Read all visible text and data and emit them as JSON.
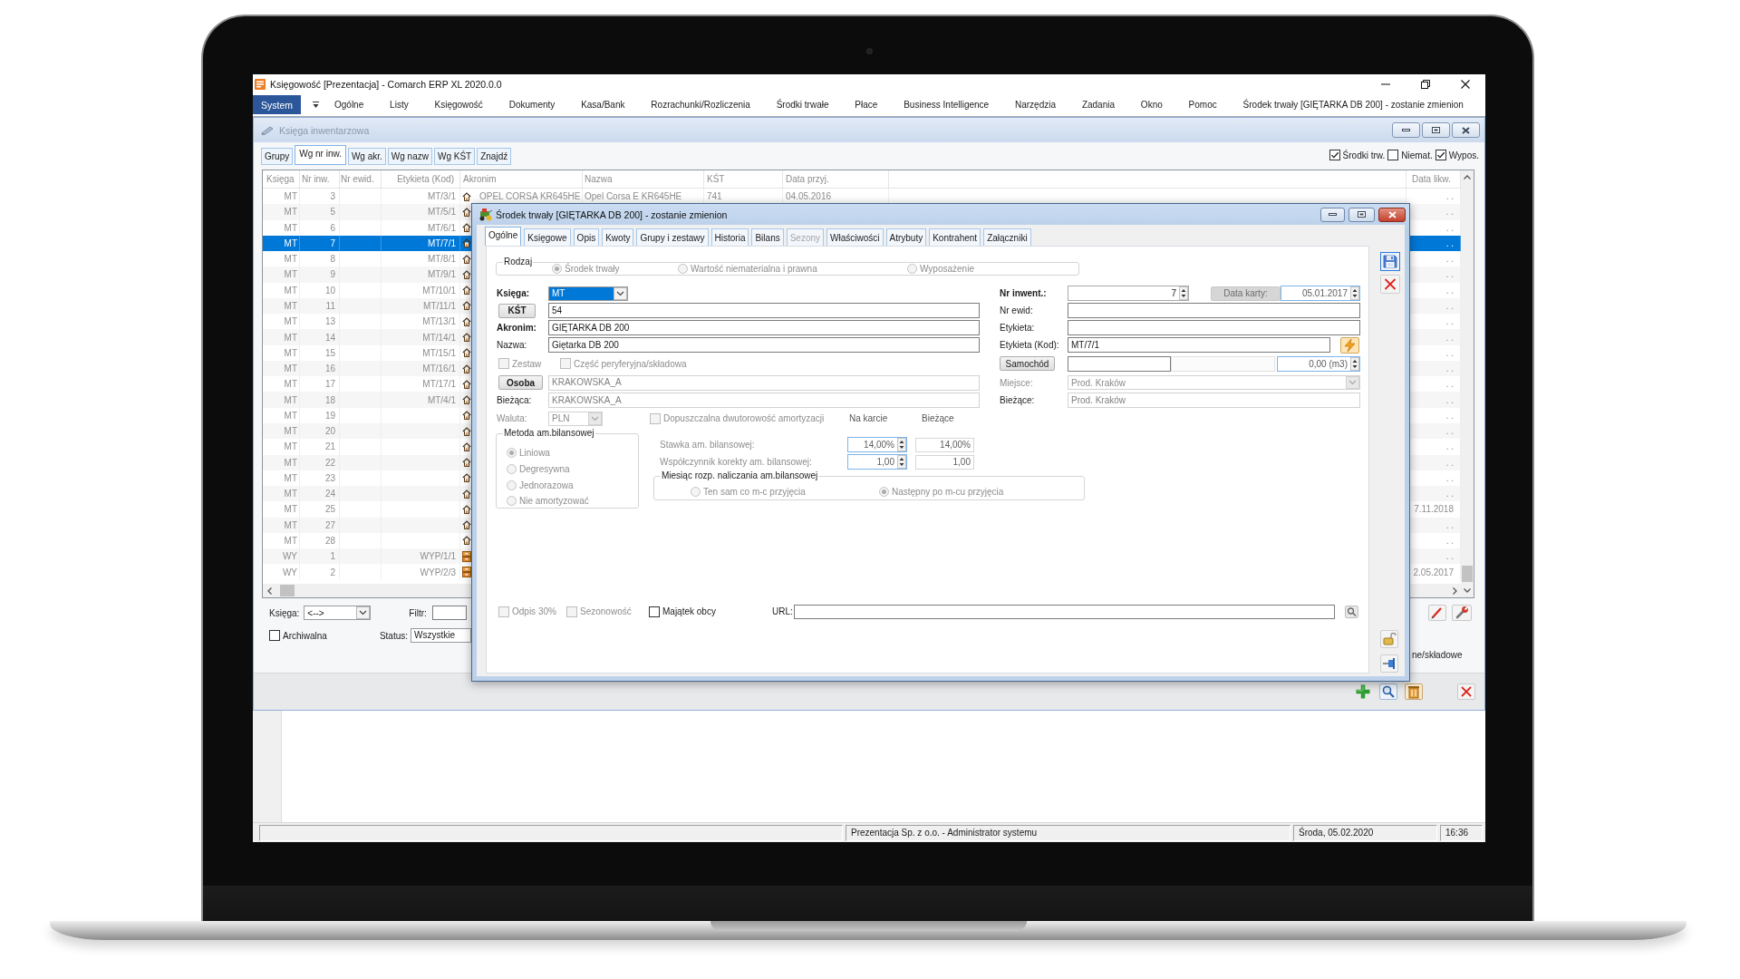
{
  "window": {
    "title": "Księgowość [Prezentacja] - Comarch ERP XL 2020.0.0"
  },
  "menu": [
    {
      "label": "System",
      "kind": "app"
    },
    {
      "label": "Ogólne",
      "kind": "menu"
    },
    {
      "label": "Listy",
      "kind": "menu"
    },
    {
      "label": "Księgowość",
      "kind": "menu"
    },
    {
      "label": "Dokumenty",
      "kind": "menu"
    },
    {
      "label": "Kasa/Bank",
      "kind": "menu"
    },
    {
      "label": "Rozrachunki/Rozliczenia",
      "kind": "menu"
    },
    {
      "label": "Środki trwałe",
      "kind": "menu"
    },
    {
      "label": "Płace",
      "kind": "menu"
    },
    {
      "label": "Business Intelligence",
      "kind": "menu"
    },
    {
      "label": "Narzędzia",
      "kind": "menu"
    },
    {
      "label": "Zadania",
      "kind": "menu"
    },
    {
      "label": "Okno",
      "kind": "menu"
    },
    {
      "label": "Pomoc",
      "kind": "menu"
    },
    {
      "label": "Środek trwały [GIĘTARKA DB 200] - zostanie zmienion",
      "kind": "menu"
    }
  ],
  "register": {
    "title": "Księga inwentarzowa",
    "tabs": [
      {
        "label": "Grupy",
        "selected": false
      },
      {
        "label": "Wg nr inw.",
        "selected": true
      },
      {
        "label": "Wg akr.",
        "selected": false
      },
      {
        "label": "Wg nazw",
        "selected": false
      },
      {
        "label": "Wg KŚT",
        "selected": false
      },
      {
        "label": "Znajdź",
        "selected": false
      }
    ],
    "filters": [
      {
        "label": "Środki trw.",
        "checked": true
      },
      {
        "label": "Niemat.",
        "checked": false
      },
      {
        "label": "Wypos.",
        "checked": true
      }
    ],
    "table": {
      "columns": [
        "Księga",
        "Nr inw.",
        "Nr ewid.",
        "Etykieta (Kod)",
        "Akronim",
        "Nazwa",
        "KŚT",
        "Data przyj.",
        "Data likw."
      ],
      "rows": [
        {
          "kind": "fixed",
          "book": "MT",
          "number": "3",
          "label_code": "MT/3/1",
          "acronym": "OPEL CORSA KR645HE",
          "name": "Opel Corsa E KR645HE",
          "kst": "741",
          "acquired": "04.05.2016",
          "disposed": ". .",
          "selected": false
        },
        {
          "kind": "fixed",
          "book": "MT",
          "number": "5",
          "label_code": "MT/5/1",
          "disposed": ". .",
          "selected": false
        },
        {
          "kind": "fixed",
          "book": "MT",
          "number": "6",
          "label_code": "MT/6/1",
          "disposed": ". .",
          "selected": false
        },
        {
          "kind": "fixed",
          "book": "MT",
          "number": "7",
          "label_code": "MT/7/1",
          "disposed": ". .",
          "selected": true
        },
        {
          "kind": "fixed",
          "book": "MT",
          "number": "8",
          "label_code": "MT/8/1",
          "disposed": ". .",
          "selected": false
        },
        {
          "kind": "fixed",
          "book": "MT",
          "number": "9",
          "label_code": "MT/9/1",
          "disposed": ". .",
          "selected": false
        },
        {
          "kind": "fixed",
          "book": "MT",
          "number": "10",
          "label_code": "MT/10/1",
          "disposed": ". .",
          "selected": false
        },
        {
          "kind": "fixed",
          "book": "MT",
          "number": "11",
          "label_code": "MT/11/1",
          "disposed": ". .",
          "selected": false
        },
        {
          "kind": "fixed",
          "book": "MT",
          "number": "13",
          "label_code": "MT/13/1",
          "disposed": ". .",
          "selected": false
        },
        {
          "kind": "fixed",
          "book": "MT",
          "number": "14",
          "label_code": "MT/14/1",
          "disposed": ". .",
          "selected": false
        },
        {
          "kind": "fixed",
          "book": "MT",
          "number": "15",
          "label_code": "MT/15/1",
          "disposed": ". .",
          "selected": false
        },
        {
          "kind": "fixed",
          "book": "MT",
          "number": "16",
          "label_code": "MT/16/1",
          "disposed": ". .",
          "selected": false
        },
        {
          "kind": "fixed",
          "book": "MT",
          "number": "17",
          "label_code": "MT/17/1",
          "disposed": ". .",
          "selected": false
        },
        {
          "kind": "fixed",
          "book": "MT",
          "number": "18",
          "label_code": "MT/4/1",
          "disposed": ". .",
          "selected": false
        },
        {
          "kind": "fixed",
          "book": "MT",
          "number": "19",
          "disposed": ". .",
          "selected": false
        },
        {
          "kind": "fixed",
          "book": "MT",
          "number": "20",
          "disposed": ". .",
          "selected": false
        },
        {
          "kind": "fixed",
          "book": "MT",
          "number": "21",
          "disposed": ". .",
          "selected": false
        },
        {
          "kind": "fixed",
          "book": "MT",
          "number": "22",
          "disposed": ". .",
          "selected": false
        },
        {
          "kind": "fixed",
          "book": "MT",
          "number": "23",
          "disposed": ". .",
          "selected": false
        },
        {
          "kind": "fixed",
          "book": "MT",
          "number": "24",
          "disposed": ". .",
          "selected": false
        },
        {
          "kind": "fixed",
          "book": "MT",
          "number": "25",
          "disposed": "7.11.2018",
          "selected": false
        },
        {
          "kind": "fixed",
          "book": "MT",
          "number": "27",
          "disposed": ". .",
          "selected": false
        },
        {
          "kind": "fixed",
          "book": "MT",
          "number": "28",
          "disposed": ". .",
          "selected": false
        },
        {
          "kind": "equipment",
          "book": "WY",
          "number": "1",
          "label_code": "WYP/1/1",
          "disposed": ". .",
          "selected": false
        },
        {
          "kind": "equipment",
          "book": "WY",
          "number": "2",
          "label_code": "WYP/2/3",
          "disposed": "2.05.2017",
          "selected": false
        }
      ]
    },
    "book": {
      "label": "Księga:",
      "value": "<-->"
    },
    "filter": {
      "label": "Filtr:"
    },
    "archived": {
      "label": "Archiwalna",
      "checked": false
    },
    "status": {
      "label": "Status:",
      "value": "Wszystkie"
    },
    "parts_label": "ne/składowe"
  },
  "dialog": {
    "title": "Środek trwały [GIĘTARKA DB 200] - zostanie zmienion",
    "tabs": [
      {
        "label": "Ogólne",
        "selected": true,
        "disabled": false
      },
      {
        "label": "Księgowe",
        "selected": false,
        "disabled": false
      },
      {
        "label": "Opis",
        "selected": false,
        "disabled": false
      },
      {
        "label": "Kwoty",
        "selected": false,
        "disabled": false
      },
      {
        "label": "Grupy i zestawy",
        "selected": false,
        "disabled": false
      },
      {
        "label": "Historia",
        "selected": false,
        "disabled": false
      },
      {
        "label": "Bilans",
        "selected": false,
        "disabled": false
      },
      {
        "label": "Sezony",
        "selected": false,
        "disabled": true
      },
      {
        "label": "Właściwości",
        "selected": false,
        "disabled": false
      },
      {
        "label": "Atrybuty",
        "selected": false,
        "disabled": false
      },
      {
        "label": "Kontrahent",
        "selected": false,
        "disabled": false
      },
      {
        "label": "Załączniki",
        "selected": false,
        "disabled": false
      }
    ],
    "type": {
      "label": "Rodzaj",
      "disabled": true,
      "options": [
        {
          "label": "Środek trwały",
          "selected": true
        },
        {
          "label": "Wartość niematerialna i prawna",
          "selected": false
        },
        {
          "label": "Wyposażenie",
          "selected": false
        }
      ]
    },
    "left_fields": [
      {
        "kind": "combo",
        "label": "Księga:",
        "value": "MT",
        "required": true,
        "focused": true,
        "disabled": false
      },
      {
        "kind": "button",
        "label": "KŚT",
        "value": "54",
        "required": true,
        "readonly": false
      },
      {
        "kind": "text",
        "label": "Akronim:",
        "value": "GIĘTARKA DB 200",
        "required": true,
        "readonly": false
      },
      {
        "kind": "text",
        "label": "Nazwa:",
        "value": "Giętarka DB 200",
        "required": false,
        "readonly": false
      },
      {
        "kind": "checks",
        "items": [
          {
            "label": "Zestaw",
            "checked": false,
            "disabled": true
          },
          {
            "label": "Część peryferyjna/składowa",
            "checked": false,
            "disabled": true
          }
        ]
      },
      {
        "kind": "button",
        "label": "Osoba",
        "value": "KRAKOWSKA_A",
        "required": true,
        "readonly": true
      },
      {
        "kind": "text",
        "label": "Bieżąca:",
        "value": "KRAKOWSKA_A",
        "required": false,
        "readonly": true
      },
      {
        "kind": "currency",
        "label": "Waluta:",
        "value": "PLN",
        "disabled": true,
        "option": {
          "label": "Dopuszczalna dwutorowość amortyzacji",
          "checked": false,
          "disabled": true
        },
        "headers": [
          "Na karcie",
          "Bieżące"
        ]
      }
    ],
    "right_fields": [
      {
        "kind": "inventory",
        "label": "Nr inwent.:",
        "value": "7",
        "required": true,
        "button": "Data karty:",
        "button_disabled": true,
        "date": "05.01.2017"
      },
      {
        "kind": "text",
        "label": "Nr ewid:",
        "required": false,
        "readonly": false
      },
      {
        "kind": "text",
        "label": "Etykieta:",
        "required": false,
        "readonly": false
      },
      {
        "kind": "code",
        "label": "Etykieta (Kod):",
        "value": "MT/7/1",
        "required": false
      },
      {
        "kind": "vehicle",
        "label": "Samochód",
        "value": "0,00 (m3)",
        "required": false
      },
      {
        "kind": "combo",
        "label": "Miejsce:",
        "value": "Prod. Kraków",
        "required": false,
        "focused": false,
        "disabled": true
      },
      {
        "kind": "text",
        "label": "Bieżące:",
        "value": "Prod. Kraków",
        "required": false,
        "readonly": true
      }
    ],
    "method": {
      "label": "Metoda am.bilansowej",
      "disabled": true,
      "options": [
        {
          "label": "Liniowa",
          "selected": true
        },
        {
          "label": "Degresywna",
          "selected": false
        },
        {
          "label": "Jednorazowa",
          "selected": false
        },
        {
          "label": "Nie amortyzować",
          "selected": false
        }
      ]
    },
    "rates": [
      {
        "label": "Stawka am. bilansowej:",
        "card": "14,00%",
        "current": "14,00%",
        "disabled": true
      },
      {
        "label": "Współczynnik korekty am. bilansowej:",
        "card": "1,00",
        "current": "1,00",
        "disabled": true
      }
    ],
    "start_month": {
      "label": "Miesiąc rozp. naliczania am.bilansowej",
      "disabled": true,
      "options": [
        {
          "label": "Ten sam co m-c przyjęcia",
          "selected": false
        },
        {
          "label": "Następny po m-cu przyjęcia",
          "selected": true
        }
      ]
    },
    "flags": [
      {
        "label": "Odpis 30%",
        "checked": false,
        "disabled": true
      },
      {
        "label": "Sezonowość",
        "checked": false,
        "disabled": true
      },
      {
        "label": "Majątek obcy",
        "checked": false,
        "disabled": false
      }
    ],
    "url": {
      "label": "URL:"
    }
  },
  "status_bar": {
    "company": "Prezentacja Sp. z o.o. - Administrator systemu",
    "date": "Środa, 05.02.2020",
    "time": "16:36"
  }
}
